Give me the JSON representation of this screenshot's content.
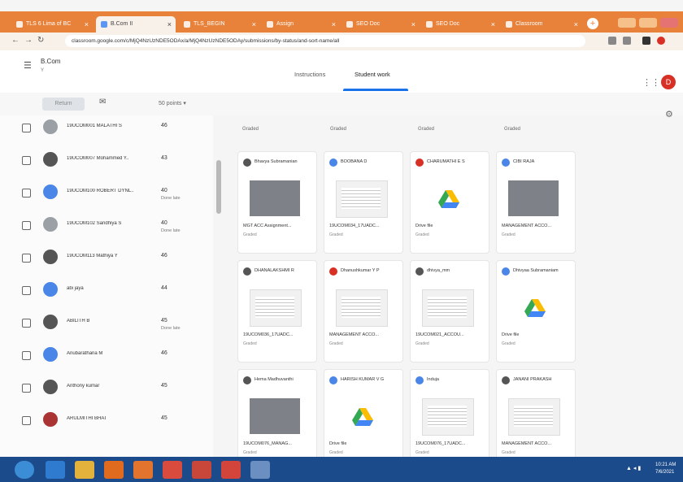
{
  "browser": {
    "tabs": [
      {
        "label": "TLS 6 Lima of BC",
        "active": false
      },
      {
        "label": "B.Com II",
        "active": true
      },
      {
        "label": "TLS_BEGIN",
        "active": false
      },
      {
        "label": "Assign",
        "active": false
      },
      {
        "label": "SEO Doc",
        "active": false
      },
      {
        "label": "SEO Doc",
        "active": false
      },
      {
        "label": "Classroom",
        "active": false
      }
    ],
    "url": "classroom.google.com/c/MjQ4NzUzNDE5ODAx/a/MjQ4NzUzNDE5ODAy/submissions/by-status/and-sort-name/all",
    "accent": "#e8823a"
  },
  "header": {
    "class_name": "B.Com",
    "class_sub": "Y",
    "tabs": [
      "Instructions",
      "Student work"
    ],
    "active_tab": "Student work",
    "avatar_letter": "D"
  },
  "toolbar": {
    "return_label": "Return",
    "points_label": "50 points"
  },
  "students": [
    {
      "name": "19UCOM001 MALATHI S",
      "grade": "46",
      "sub": ""
    },
    {
      "name": "19UCOM007 Mohammed Y..",
      "grade": "43",
      "sub": ""
    },
    {
      "name": "19UCOM100 ROBERT DYNL..",
      "grade": "40",
      "sub": "Done late"
    },
    {
      "name": "19UCOM102 Sandhiya S",
      "grade": "40",
      "sub": "Done late"
    },
    {
      "name": "19UCOM113 Mathiya Y",
      "grade": "46",
      "sub": ""
    },
    {
      "name": "abi jaya",
      "grade": "44",
      "sub": ""
    },
    {
      "name": "ABILITH B",
      "grade": "45",
      "sub": "Done late"
    },
    {
      "name": "Anubarathana M",
      "grade": "46",
      "sub": ""
    },
    {
      "name": "Anthony kumar",
      "grade": "45",
      "sub": ""
    },
    {
      "name": "ARULMITHI BHAT",
      "grade": "45",
      "sub": ""
    }
  ],
  "columns": [
    "Graded",
    "Graded",
    "Graded",
    "Graded"
  ],
  "cards": [
    {
      "name": "Bhavya Subramanian",
      "file": "MGT ACC Assignment...",
      "status": "Graded",
      "thumb": "image"
    },
    {
      "name": "BOOBANA D",
      "file": "19UCOM034_17UADC...",
      "status": "Graded",
      "thumb": "doc"
    },
    {
      "name": "CHARUMATHI E S",
      "file": "Drive file",
      "status": "Graded",
      "thumb": "drive"
    },
    {
      "name": "CIBI RAJA",
      "file": "MANAGEMENT ACCO...",
      "status": "Graded",
      "thumb": "image"
    },
    {
      "name": "DHANALAKSHMI R",
      "file": "19UCOM036_17UADC...",
      "status": "Graded",
      "thumb": "doc"
    },
    {
      "name": "Dhanushkumar Y P",
      "file": "MANAGEMENT ACCO...",
      "status": "Graded",
      "thumb": "doc"
    },
    {
      "name": "dhivya_mm",
      "file": "19UCOM021_ACCOU...",
      "status": "Graded",
      "thumb": "doc"
    },
    {
      "name": "Dhivyaa Subramaniam",
      "file": "Drive file",
      "status": "Graded",
      "thumb": "drive"
    },
    {
      "name": "Hema Madhuvanthi",
      "file": "19UCOM076_MANAG...",
      "status": "Graded",
      "thumb": "image"
    },
    {
      "name": "HARISH KUMAR V G",
      "file": "Drive file",
      "status": "Graded",
      "thumb": "drive"
    },
    {
      "name": "Induja",
      "file": "19UCOM076_17UADC...",
      "status": "Graded",
      "thumb": "doc"
    },
    {
      "name": "JANANI PRAKASH",
      "file": "MANAGEMENT ACCO...",
      "status": "Graded",
      "thumb": "doc"
    }
  ],
  "taskbar": {
    "clock_time": "10:21 AM",
    "clock_date": "7/6/2021"
  }
}
